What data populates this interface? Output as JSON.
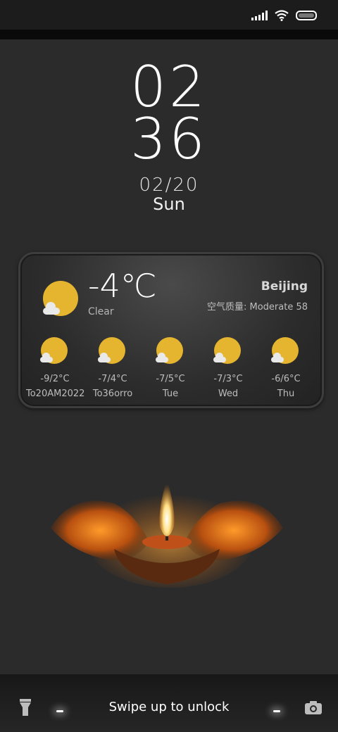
{
  "status_bar": {
    "icons": [
      "signal-icon",
      "wifi-icon",
      "battery-icon"
    ]
  },
  "clock": {
    "hours": "02",
    "minutes": "36",
    "date": "02/20",
    "day": "Sun"
  },
  "weather": {
    "current": {
      "temp": "-4℃",
      "condition": "Clear",
      "city": "Beijing",
      "air_quality": "空气质量: Moderate 58",
      "icon": "sun-cloud-icon"
    },
    "forecast": [
      {
        "range": "-9/2°C",
        "day": "To20AM2022",
        "icon": "sun-cloud-icon"
      },
      {
        "range": "-7/4°C",
        "day": "To36orro",
        "icon": "sun-cloud-icon"
      },
      {
        "range": "-7/5°C",
        "day": "Tue",
        "icon": "sun-cloud-icon"
      },
      {
        "range": "-7/3°C",
        "day": "Wed",
        "icon": "sun-cloud-icon"
      },
      {
        "range": "-6/6°C",
        "day": "Thu",
        "icon": "sun-cloud-icon"
      }
    ],
    "colors": {
      "sun": "#e5b530",
      "cloud": "#e9e9e9"
    }
  },
  "lockscreen": {
    "unlock_hint": "Swipe up to unlock",
    "left_shortcut": "flashlight-icon",
    "right_shortcut": "camera-icon"
  }
}
